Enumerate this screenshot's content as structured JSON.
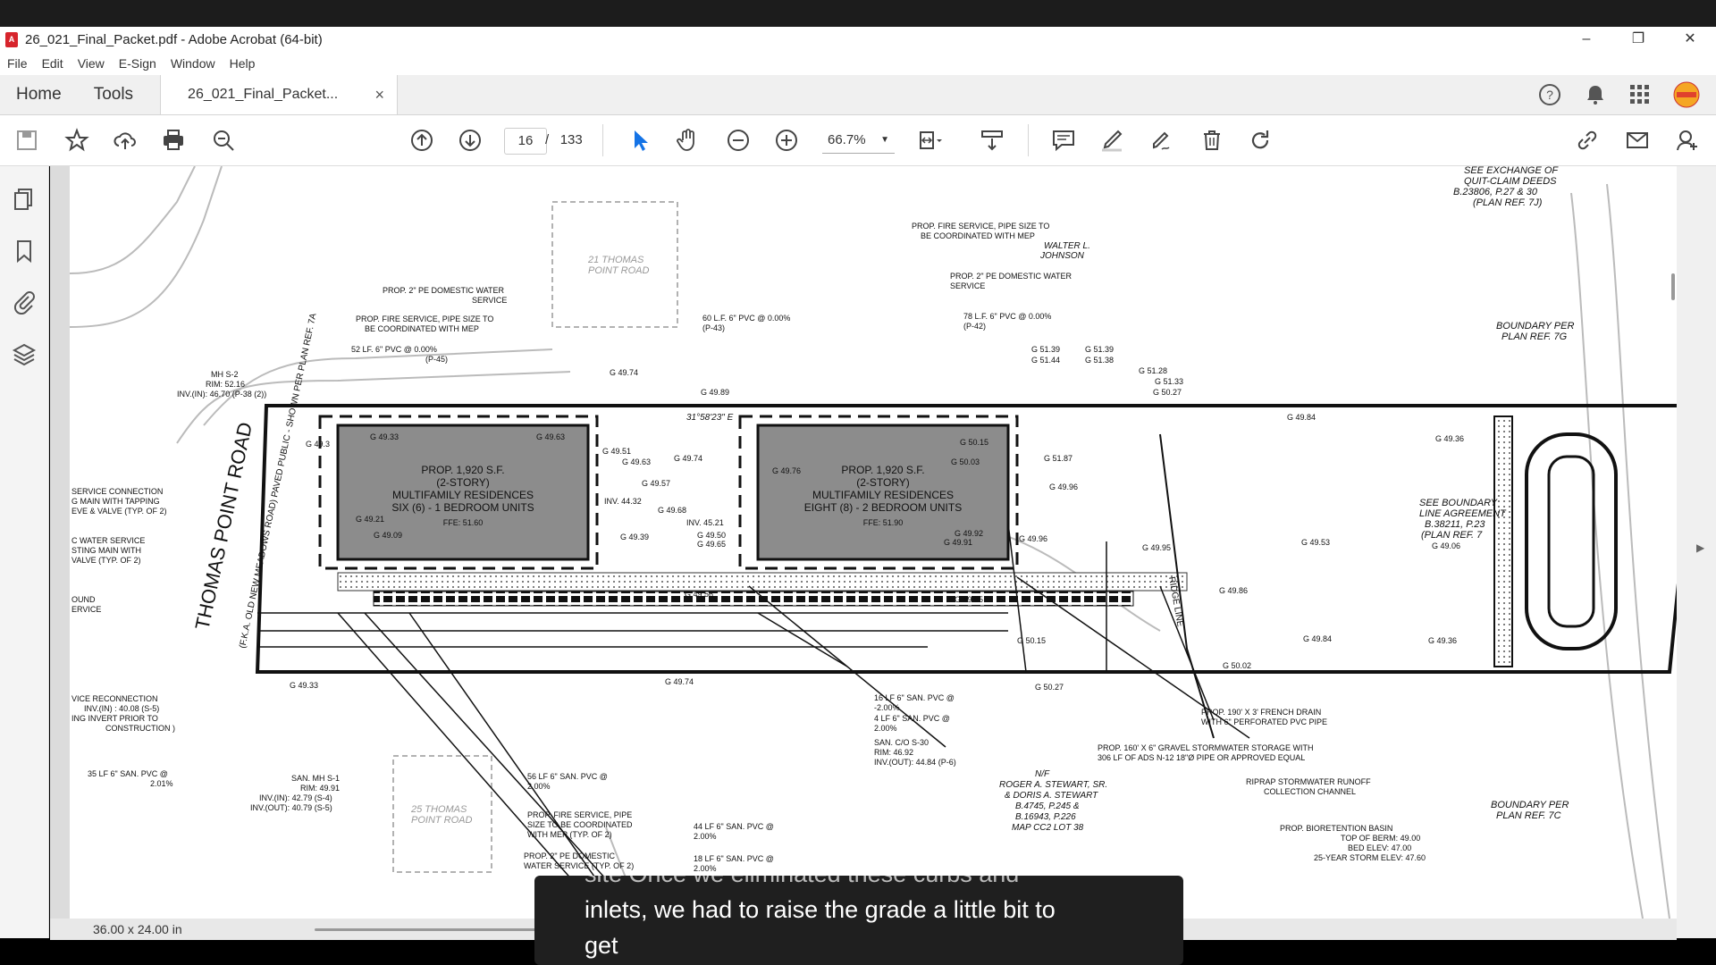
{
  "window": {
    "title": "26_021_Final_Packet.pdf - Adobe Acrobat (64-bit)",
    "controls": [
      "–",
      "❐",
      "✕"
    ]
  },
  "menu": [
    "File",
    "Edit",
    "View",
    "E-Sign",
    "Window",
    "Help"
  ],
  "tabs": {
    "home": "Home",
    "tools": "Tools",
    "document": "26_021_Final_Packet...",
    "close": "×"
  },
  "toolbar": {
    "page_current": "16",
    "page_sep": "/",
    "page_total": "133",
    "zoom": "66.7%"
  },
  "status": {
    "page_size": "36.00 x 24.00 in"
  },
  "caption": {
    "faded": "site Once we eliminated these curbs and",
    "line1": "inlets, we had to raise the grade a little bit to",
    "line2": "get"
  },
  "drawing": {
    "building_left": {
      "l1": "PROP. 1,920 S.F.",
      "l2": "(2-STORY)",
      "l3": "MULTIFAMILY RESIDENCES",
      "l4": "SIX (6) - 1 BEDROOM UNITS",
      "ffe": "FFE: 51.60"
    },
    "building_right": {
      "l1": "PROP. 1,920 S.F.",
      "l2": "(2-STORY)",
      "l3": "MULTIFAMILY RESIDENCES",
      "l4": "EIGHT (8) - 2 BEDROOM UNITS",
      "ffe": "FFE: 51.90"
    },
    "road": "THOMAS POINT ROAD",
    "road_sub": "(F.K.A. OLD NEW MEADOWS ROAD) PAVED PUBLIC - SHOWN PER PLAN REF. 7A",
    "ridge": "RIDGE LINE",
    "notes": {
      "n1": "PROP. 2\" PE DOMESTIC WATER",
      "n1b": "SERVICE",
      "n2": "PROP. FIRE SERVICE, PIPE SIZE TO",
      "n2b": "BE COORDINATED WITH MEP",
      "n3": "52 LF. 6\" PVC @ 0.00%",
      "n3b": "(P-45)",
      "n4": "60 L.F. 6\" PVC @ 0.00%",
      "n4b": "(P-43)",
      "n5": "PROP. FIRE SERVICE, PIPE SIZE TO",
      "n5b": "BE COORDINATED WITH MEP",
      "n6": "PROP. 2\" PE DOMESTIC WATER",
      "n6b": "SERVICE",
      "n7": "78 L.F. 6\" PVC @ 0.00%",
      "n7b": "(P-42)",
      "n8": "MH S-2",
      "n8b": "RIM: 52.16",
      "n8c": "INV.(IN): 46.70 (P-38 (2))",
      "n9": "16 LF 6\" SAN. PVC @",
      "n9b": "-2.00%",
      "n10": "4 LF 6\" SAN. PVC @",
      "n10b": "2.00%",
      "n11": "SAN. C/O S-30",
      "n11b": "RIM: 46.92",
      "n11c": "INV.(OUT): 44.84 (P-6)",
      "n12": "PROP. 190' X 3' FRENCH DRAIN",
      "n12b": "WITH 6\" PERFORATED PVC PIPE",
      "n13": "PROP. 160' X 6\" GRAVEL STORMWATER STORAGE WITH",
      "n13b": "306 LF OF ADS N-12 18\"Ø PIPE OR APPROVED EQUAL",
      "n14": "RIPRAP STORMWATER RUNOFF",
      "n14b": "COLLECTION CHANNEL",
      "n15": "PROP. BIORETENTION BASIN",
      "n15b": "TOP OF BERM: 49.00",
      "n15c": "BED ELEV: 47.00",
      "n15d": "25-YEAR STORM ELEV: 47.60",
      "n16": "BOUNDARY PER",
      "n16b": "PLAN REF. 7C",
      "n17": "BOUNDARY PER",
      "n17b": "PLAN REF. 7G",
      "n18": "SEE EXCHANGE OF",
      "n18b": "QUIT-CLAIM DEEDS",
      "n18c": "B.23806, P.27 & 30",
      "n18d": "(PLAN REF. 7J)",
      "n19": "56 LF 6\" SAN. PVC @",
      "n19b": "2.00%",
      "n20": "PROP. FIRE SERVICE, PIPE",
      "n20b": "SIZE TO BE COORDINATED",
      "n20c": "WITH MEP (TYP. OF 2)",
      "n21": "PROP. 2\" PE DOMESTIC",
      "n21b": "WATER SERVICE (TYP. OF 2)",
      "n22": "44 LF 6\" SAN. PVC @",
      "n22b": "2.00%",
      "n23": "18 LF 6\" SAN. PVC @",
      "n23b": "2.00%",
      "n24": "SAN. MH S-1",
      "n24b": "RIM: 49.91",
      "n24c": "INV.(IN): 42.79 (S-4)",
      "n24d": "INV.(OUT): 40.79 (S-5)",
      "n25": "35 LF 6\" SAN. PVC @",
      "n25b": "2.01%",
      "n26": "N/F",
      "n26b": "ROGER A. STEWART, SR.",
      "n26c": "& DORIS A. STEWART",
      "n26d": "B.4745, P.245 &",
      "n26e": "B.16943, P.226",
      "n26f": "MAP CC2 LOT 38",
      "n27": "SERVICE CONNECTION",
      "n27b": "G MAIN WITH TAPPING",
      "n27c": "EVE & VALVE (TYP. OF 2)",
      "n28": "C WATER SERVICE",
      "n28b": "STING MAIN WITH",
      "n28c": "VALVE (TYP. OF 2)",
      "n29": "OUND",
      "n29b": "ERVICE",
      "n30": "VICE RECONNECTION",
      "n30b": "INV.(IN) : 40.08 (S-5)",
      "n30c": "ING INVERT PRIOR TO",
      "n30d": "CONSTRUCTION )",
      "n31": "SEE BOUNDARY",
      "n31b": "LINE AGREEMENT",
      "n31c": "B.38211, P.23",
      "n31d": "(PLAN REF. 7",
      "n32": "21 THOMAS",
      "n32b": "POINT ROAD",
      "n33": "25 THOMAS",
      "n33b": "POINT ROAD",
      "n34": "WALTER L.",
      "n34b": "JOHNSON",
      "bearing": "31°58'23\" E"
    },
    "grades": {
      "g1": "G 49.74",
      "g2": "G 49.89",
      "g3": "G 49.33",
      "g4": "G 49.63",
      "g5": "G 49.51",
      "g6": "G 49.63",
      "g7": "G 49.74",
      "g8": "G 49.57",
      "g9": "INV. 44.32",
      "g10": "G 49.68",
      "g11": "INV. 45.21",
      "g12": "G 49.65",
      "g13": "G 49.50",
      "g14": "G 49.39",
      "g15": "G 49.21",
      "g16": "G 49.09",
      "g17": "G 49.76",
      "g18": "G 50.15",
      "g19": "G 50.03",
      "g20": "G 51.87",
      "g21": "G 49.96",
      "g22": "G 49.92",
      "g23": "G 49.91",
      "g24": "G 49.96",
      "g25": "G 49.95",
      "g26": "G 51.39",
      "g27": "G 51.44",
      "g28": "G 51.39",
      "g29": "G 51.38",
      "g30": "G 51.28",
      "g31": "G 51.33",
      "g32": "G 50.27",
      "g33": "G 49.84",
      "g34": "G 49.36",
      "g35": "G 49.53",
      "g36": "G 49.06",
      "g37": "G 49.86",
      "g38": "G 49.95",
      "g39": "G 50.15",
      "g40": "G 50.02",
      "g41": "G 49.84",
      "g42": "G 49.36",
      "g43": "G 50.27",
      "g44": "G 49.74",
      "g45": "G 49.33",
      "g46": "G 49.56",
      "g47": "G 49.3"
    }
  },
  "colors": {
    "accent": "#1473e6",
    "building_fill": "#8c8c8c"
  }
}
